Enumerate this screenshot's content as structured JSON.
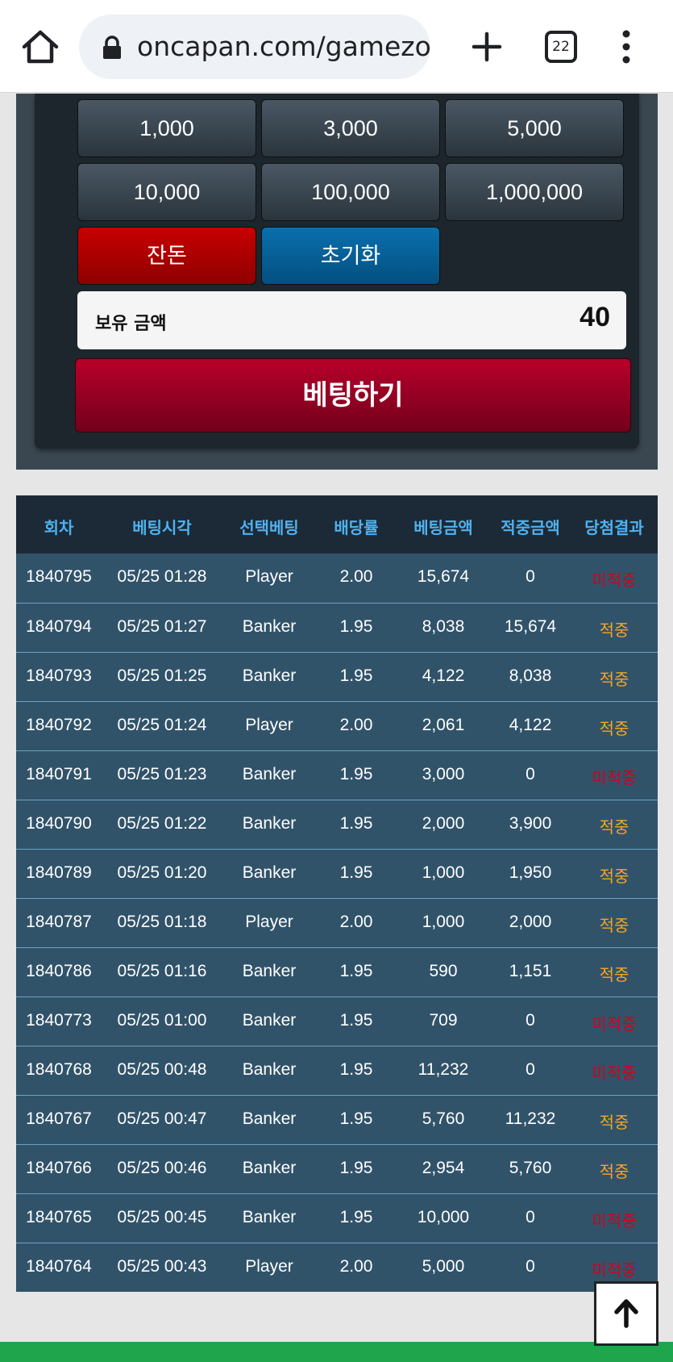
{
  "browser": {
    "url": "oncapan.com/gamezo",
    "tab_count": "22"
  },
  "amount_buttons": [
    "1,000",
    "3,000",
    "5,000",
    "10,000",
    "100,000",
    "1,000,000"
  ],
  "action_buttons": {
    "change": "잔돈",
    "reset": "초기화"
  },
  "balance": {
    "label": "보유 금액",
    "value": "40"
  },
  "bet_button": "베팅하기",
  "table": {
    "headers": [
      "회차",
      "베팅시각",
      "선택베팅",
      "배당률",
      "베팅금액",
      "적중금액",
      "당첨결과"
    ],
    "rows": [
      [
        "1840795",
        "05/25 01:28",
        "Player",
        "2.00",
        "15,674",
        "0",
        "미적중"
      ],
      [
        "1840794",
        "05/25 01:27",
        "Banker",
        "1.95",
        "8,038",
        "15,674",
        "적중"
      ],
      [
        "1840793",
        "05/25 01:25",
        "Banker",
        "1.95",
        "4,122",
        "8,038",
        "적중"
      ],
      [
        "1840792",
        "05/25 01:24",
        "Player",
        "2.00",
        "2,061",
        "4,122",
        "적중"
      ],
      [
        "1840791",
        "05/25 01:23",
        "Banker",
        "1.95",
        "3,000",
        "0",
        "미적중"
      ],
      [
        "1840790",
        "05/25 01:22",
        "Banker",
        "1.95",
        "2,000",
        "3,900",
        "적중"
      ],
      [
        "1840789",
        "05/25 01:20",
        "Banker",
        "1.95",
        "1,000",
        "1,950",
        "적중"
      ],
      [
        "1840787",
        "05/25 01:18",
        "Player",
        "2.00",
        "1,000",
        "2,000",
        "적중"
      ],
      [
        "1840786",
        "05/25 01:16",
        "Banker",
        "1.95",
        "590",
        "1,151",
        "적중"
      ],
      [
        "1840773",
        "05/25 01:00",
        "Banker",
        "1.95",
        "709",
        "0",
        "미적중"
      ],
      [
        "1840768",
        "05/25 00:48",
        "Banker",
        "1.95",
        "11,232",
        "0",
        "미적중"
      ],
      [
        "1840767",
        "05/25 00:47",
        "Banker",
        "1.95",
        "5,760",
        "11,232",
        "적중"
      ],
      [
        "1840766",
        "05/25 00:46",
        "Banker",
        "1.95",
        "2,954",
        "5,760",
        "적중"
      ],
      [
        "1840765",
        "05/25 00:45",
        "Banker",
        "1.95",
        "10,000",
        "0",
        "미적중"
      ],
      [
        "1840764",
        "05/25 00:43",
        "Player",
        "2.00",
        "5,000",
        "0",
        "미적중"
      ]
    ]
  },
  "colors": {
    "hit": "#f5a623",
    "miss": "#d0021b",
    "header_text": "#4fb1f0"
  }
}
